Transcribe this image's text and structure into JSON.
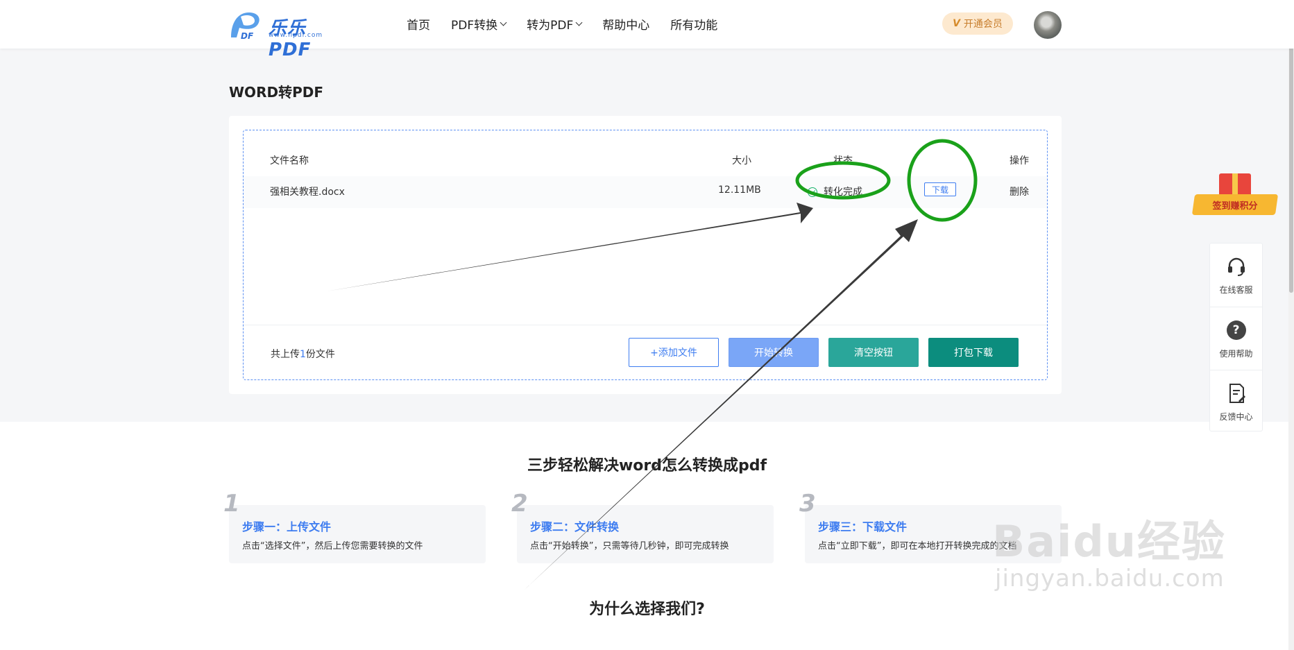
{
  "header": {
    "logo_text": "乐乐PDF",
    "logo_url_text": "www.llpdf.com",
    "nav": [
      {
        "label": "首页",
        "has_dropdown": false
      },
      {
        "label": "PDF转换",
        "has_dropdown": true
      },
      {
        "label": "转为PDF",
        "has_dropdown": true
      },
      {
        "label": "帮助中心",
        "has_dropdown": false
      },
      {
        "label": "所有功能",
        "has_dropdown": false
      }
    ],
    "vip_label": "开通会员"
  },
  "converter": {
    "page_title": "WORD转PDF",
    "columns": {
      "name": "文件名称",
      "size": "大小",
      "status": "状态",
      "action": "操作"
    },
    "files": [
      {
        "name": "强相关教程.docx",
        "size": "12.11MB",
        "status": "转化完成",
        "download_label": "下载",
        "delete_label": "删除"
      }
    ],
    "upload_count_prefix": "共上传",
    "upload_count": "1",
    "upload_count_suffix": "份文件",
    "buttons": {
      "add": "+添加文件",
      "start": "开始转换",
      "clear": "清空按钮",
      "pack": "打包下载"
    }
  },
  "steps": {
    "title": "三步轻松解决word怎么转换成pdf",
    "items": [
      {
        "num": "1",
        "title": "步骤一：上传文件",
        "desc": "点击“选择文件”，然后上传您需要转换的文件"
      },
      {
        "num": "2",
        "title": "步骤二：文件转换",
        "desc": "点击“开始转换”，只需等待几秒钟，即可完成转换"
      },
      {
        "num": "3",
        "title": "步骤三：下载文件",
        "desc": "点击“立即下载”，即可在本地打开转换完成的文档"
      }
    ]
  },
  "why_title": "为什么选择我们?",
  "side_tools": {
    "gift_label": "签到赚积分",
    "items": [
      {
        "label": "在线客服",
        "icon": "headset-icon"
      },
      {
        "label": "使用帮助",
        "icon": "help-icon"
      },
      {
        "label": "反馈中心",
        "icon": "feedback-icon"
      }
    ]
  },
  "watermark": {
    "main": "Baidu经验",
    "sub": "jingyan.baidu.com"
  },
  "colors": {
    "brand": "#2f6fd6",
    "accent": "#3d7cf0",
    "success": "#19b36b",
    "annotation": "#1aa11a",
    "teal": "#2aa69a",
    "dark_teal": "#0c8d7e"
  }
}
